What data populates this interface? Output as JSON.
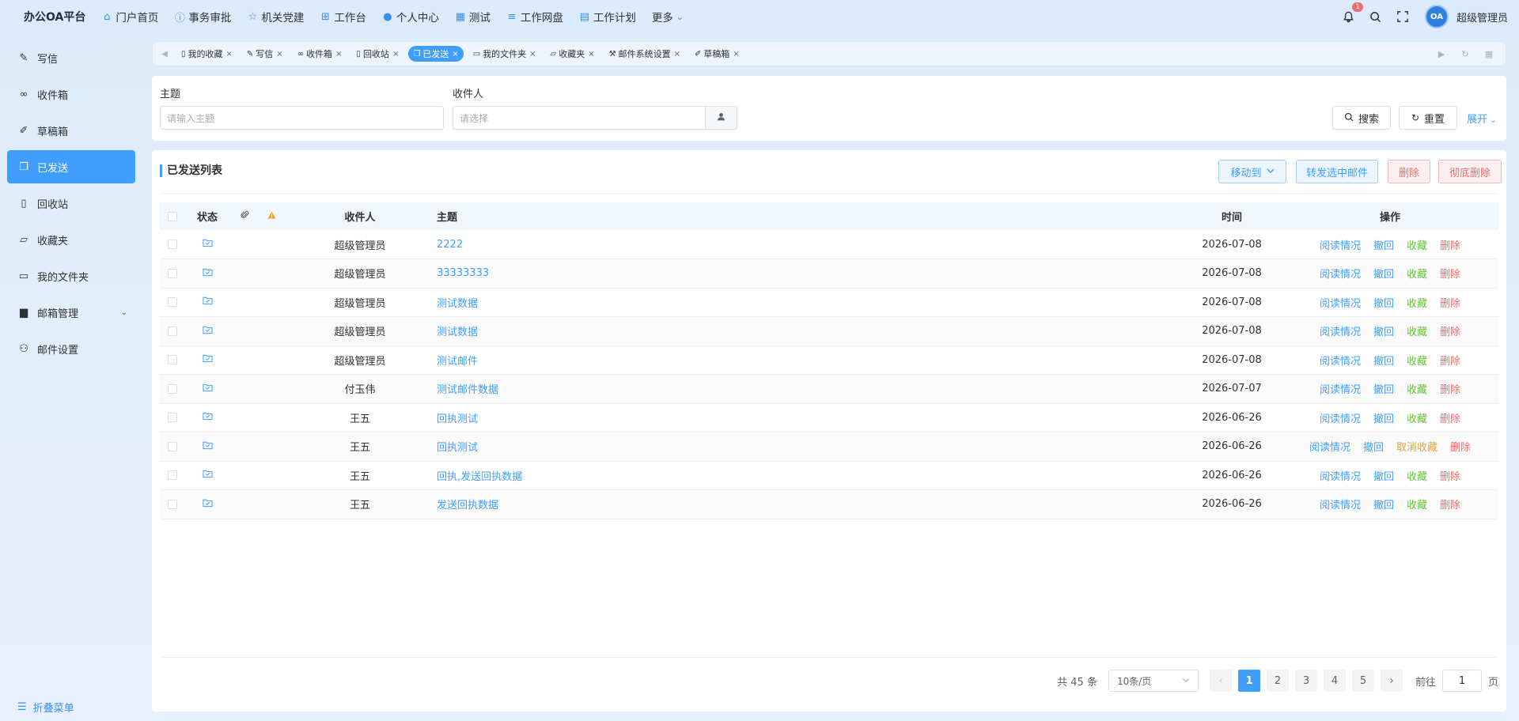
{
  "topbar": {
    "brand": "办公OA平台",
    "nav": [
      {
        "label": "门户首页",
        "icon": "home-icon"
      },
      {
        "label": "事务审批",
        "icon": "info-icon"
      },
      {
        "label": "机关党建",
        "icon": "star-icon"
      },
      {
        "label": "工作台",
        "icon": "sitemap-icon"
      },
      {
        "label": "个人中心",
        "icon": "user-icon"
      },
      {
        "label": "测试",
        "icon": "grid-icon"
      },
      {
        "label": "工作网盘",
        "icon": "database-icon"
      },
      {
        "label": "工作计划",
        "icon": "calendar-icon"
      },
      {
        "label": "更多",
        "icon": "chevron-down-icon"
      }
    ],
    "notification_count": "1",
    "avatar_text": "OA",
    "username": "超级管理员"
  },
  "sidebar": {
    "items": [
      {
        "label": "写信",
        "icon": "compose-icon"
      },
      {
        "label": "收件箱",
        "icon": "inbox-icon"
      },
      {
        "label": "草稿箱",
        "icon": "draft-icon"
      },
      {
        "label": "已发送",
        "icon": "sent-icon"
      },
      {
        "label": "回收站",
        "icon": "trash-icon"
      },
      {
        "label": "收藏夹",
        "icon": "folder-open-icon"
      },
      {
        "label": "我的文件夹",
        "icon": "folder-icon"
      },
      {
        "label": "邮箱管理",
        "icon": "mailbox-admin-icon"
      },
      {
        "label": "邮件设置",
        "icon": "user-settings-icon"
      }
    ],
    "active_index": 3,
    "collapse_label": "折叠菜单"
  },
  "tabs": {
    "items": [
      {
        "label": "我的收藏",
        "icon": "file-icon"
      },
      {
        "label": "写信",
        "icon": "compose-icon"
      },
      {
        "label": "收件箱",
        "icon": "inbox-icon"
      },
      {
        "label": "回收站",
        "icon": "trash-icon"
      },
      {
        "label": "已发送",
        "icon": "sent-icon"
      },
      {
        "label": "我的文件夹",
        "icon": "folder-icon"
      },
      {
        "label": "收藏夹",
        "icon": "folder-open-icon"
      },
      {
        "label": "邮件系统设置",
        "icon": "tool-icon"
      },
      {
        "label": "草稿箱",
        "icon": "draft-icon"
      }
    ],
    "active_index": 4
  },
  "search": {
    "subject_label": "主题",
    "subject_placeholder": "请输入主题",
    "recipient_label": "收件人",
    "recipient_placeholder": "请选择",
    "search_button": "搜索",
    "reset_button": "重置",
    "expand_link": "展开"
  },
  "list": {
    "title": "已发送列表",
    "actions": {
      "move_to": "移动到",
      "forward": "转发选中邮件",
      "delete": "删除",
      "purge": "彻底删除"
    },
    "columns": {
      "status": "状态",
      "recipient": "收件人",
      "subject": "主题",
      "time": "时间",
      "operations": "操作"
    },
    "op_labels": {
      "read_status": "阅读情况",
      "recall": "撤回",
      "favorite": "收藏",
      "unfavorite": "取消收藏",
      "delete": "删除"
    },
    "rows": [
      {
        "recipient": "超级管理员",
        "subject": "2222",
        "time": "2026-07-08",
        "favorited": false
      },
      {
        "recipient": "超级管理员",
        "subject": "33333333",
        "time": "2026-07-08",
        "favorited": false
      },
      {
        "recipient": "超级管理员",
        "subject": "测试数据",
        "time": "2026-07-08",
        "favorited": false
      },
      {
        "recipient": "超级管理员",
        "subject": "测试数据",
        "time": "2026-07-08",
        "favorited": false
      },
      {
        "recipient": "超级管理员",
        "subject": "测试邮件",
        "time": "2026-07-08",
        "favorited": false
      },
      {
        "recipient": "付玉伟",
        "subject": "测试邮件数据",
        "time": "2026-07-07",
        "favorited": false
      },
      {
        "recipient": "王五",
        "subject": "回执测试",
        "time": "2026-06-26",
        "favorited": false
      },
      {
        "recipient": "王五",
        "subject": "回执测试",
        "time": "2026-06-26",
        "favorited": true
      },
      {
        "recipient": "王五",
        "subject": "回执,发送回执数据",
        "time": "2026-06-26",
        "favorited": false
      },
      {
        "recipient": "王五",
        "subject": "发送回执数据",
        "time": "2026-06-26",
        "favorited": false
      }
    ]
  },
  "pagination": {
    "total_text": "共 45 条",
    "page_size": "10条/页",
    "pages": [
      "1",
      "2",
      "3",
      "4",
      "5"
    ],
    "current_page": "1",
    "goto_label": "前往",
    "goto_value": "1",
    "page_suffix": "页"
  }
}
